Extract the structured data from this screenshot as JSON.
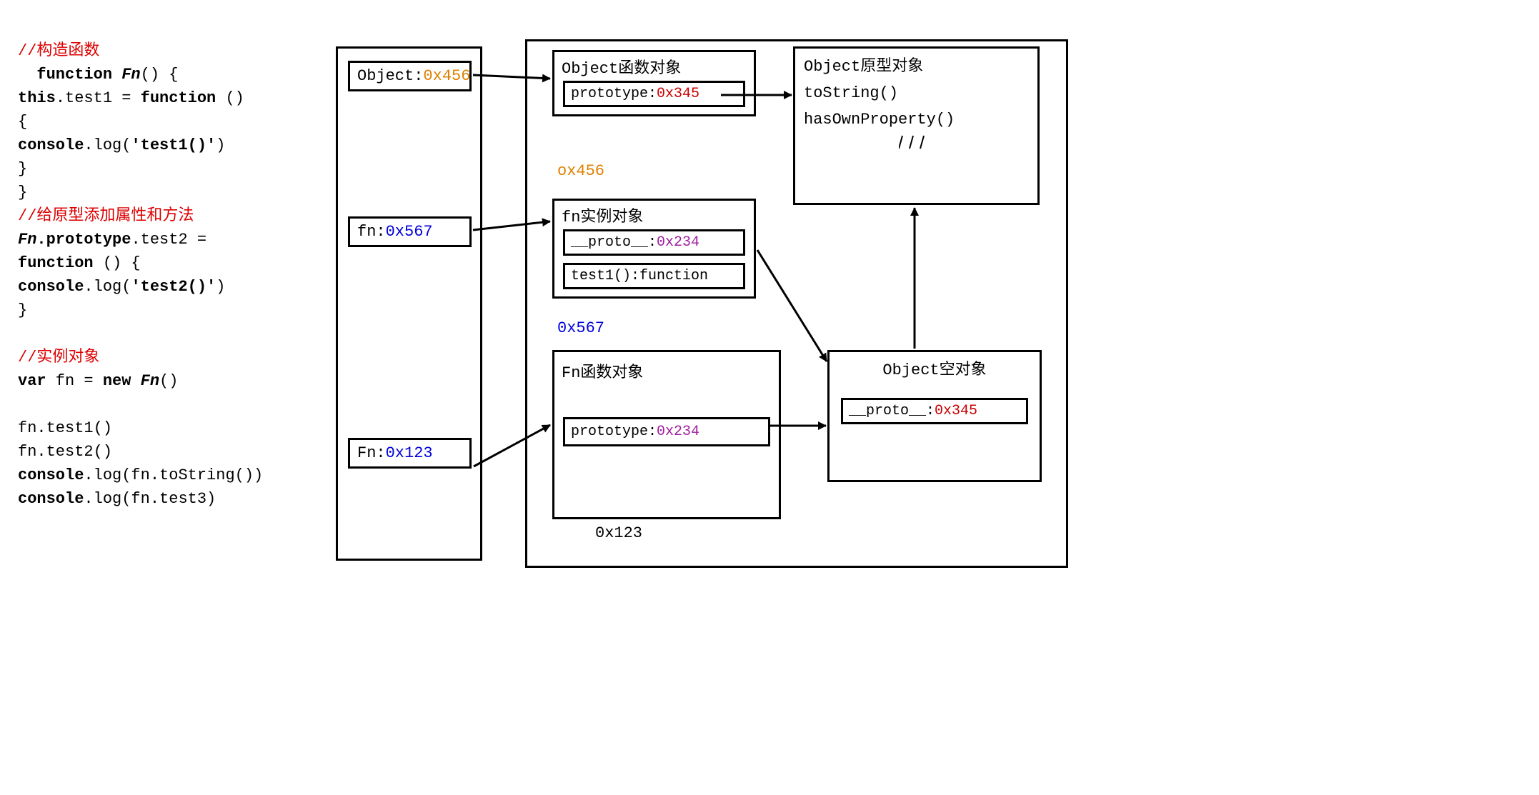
{
  "code": {
    "c1": "//构造函数",
    "l1_kw": "function",
    "l1_fn": "Fn",
    "l1_rest": "() {",
    "l2_pre": "    ",
    "l2_this": "this",
    "l2_rest": ".test1 = ",
    "l2_kw2": "function",
    "l2_end": " ()",
    "l2_open": "{",
    "l3_pre": "      ",
    "l3_console": "console",
    "l3_rest": ".log(",
    "l3_str": "'test1()'",
    "l3_end": ")",
    "l4": "    }",
    "l5": "  }",
    "c2": "//给原型添加属性和方法",
    "l6_pre": "  ",
    "l6_fn": "Fn",
    "l6_proto": ".prototype",
    "l6_rest": ".test2 =",
    "l7_kw": "function",
    "l7_rest": " () {",
    "l8_pre": "    ",
    "l8_console": "console",
    "l8_rest": ".log(",
    "l8_str": "'test2()'",
    "l8_end": ")",
    "l9": "  }",
    "c3": "//实例对象",
    "l10_pre": "  ",
    "l10_var": "var",
    "l10_rest": " fn = ",
    "l10_new": "new",
    "l10_sp": " ",
    "l10_fn": "Fn",
    "l10_end": "()",
    "l11": "  fn.test1()",
    "l12": "  fn.test2()",
    "l13_pre": "  ",
    "l13_console": "console",
    "l13_rest": ".log(fn.toString())",
    "l14_pre": "  ",
    "l14_console": "console",
    "l14_rest": ".log(fn.test3)"
  },
  "stack": {
    "obj_label": "Object:",
    "obj_addr": "0x456",
    "fn_label": "fn:",
    "fn_addr": "0x567",
    "Fn_label": "Fn:",
    "Fn_addr": "0x123"
  },
  "heap": {
    "objectFunc": {
      "title": "Object函数对象",
      "prop_key": "prototype:",
      "prop_val": "0x345"
    },
    "objectFunc_label": "ox456",
    "fnInst": {
      "title": "fn实例对象",
      "proto_key": "__proto__:",
      "proto_val": "0x234",
      "test1": "test1():function"
    },
    "fnInst_label": "0x567",
    "FnFunc": {
      "title": "Fn函数对象",
      "proto_key": "prototype:",
      "proto_val": "0x234"
    },
    "FnFunc_label": "0x123"
  },
  "objectProto": {
    "title": "Object原型对象",
    "m1": "toString()",
    "m2": "hasOwnProperty()"
  },
  "objectEmpty": {
    "title": "Object空对象",
    "proto_key": "__proto__:",
    "proto_val": "0x345"
  }
}
